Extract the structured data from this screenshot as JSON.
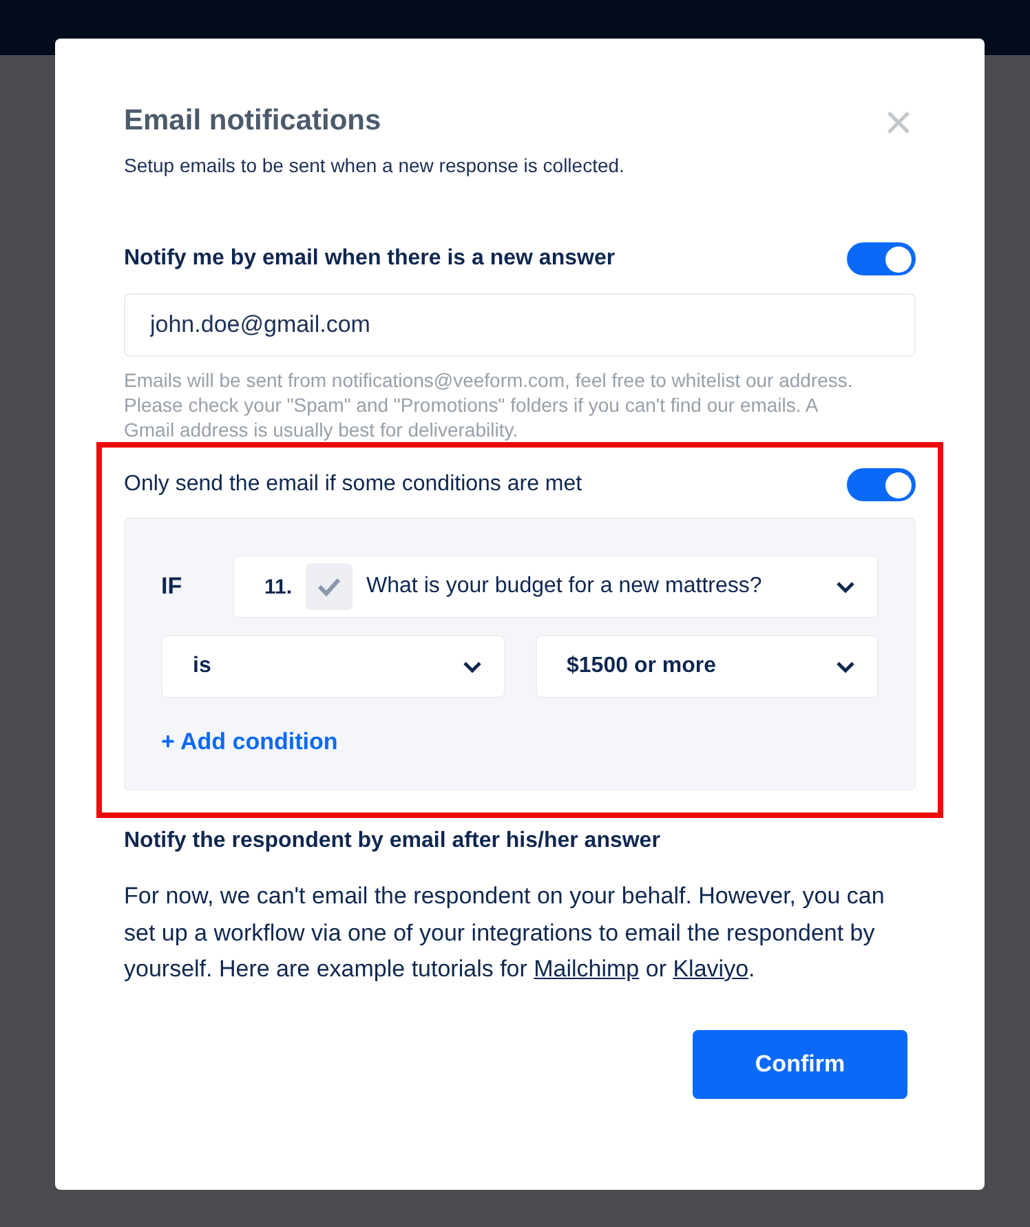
{
  "dialog": {
    "title": "Email notifications",
    "subtitle": "Setup emails to be sent when a new response is collected.",
    "close": "×"
  },
  "notify_me": {
    "label": "Notify me by email when there is a new answer",
    "on": true,
    "email": "john.doe@gmail.com",
    "hint": "Emails will be sent from notifications@veeform.com, feel free to whitelist our address. Please check your \"Spam\" and \"Promotions\" folders if you can't find our emails. A Gmail address is usually best for deliverability."
  },
  "conditions": {
    "highlighted": true,
    "label": "Only send the email if some conditions are met",
    "on": true,
    "if_label": "IF",
    "question_number": "11.",
    "question": "What is your budget for a new mattress?",
    "operator": "is",
    "value": "$1500 or more",
    "add": "+ Add condition"
  },
  "respondent": {
    "heading": "Notify the respondent by email after his/her answer",
    "text_before": "For now, we can't email the respondent on your behalf. However, you can set up a workflow via one of your integrations to email the respondent by yourself. Here are example tutorials for ",
    "link_1": "Mailchimp",
    "text_between": " or ",
    "link_2": "Klaviyo",
    "text_after": "."
  },
  "buttons": [
    "Confirm"
  ]
}
